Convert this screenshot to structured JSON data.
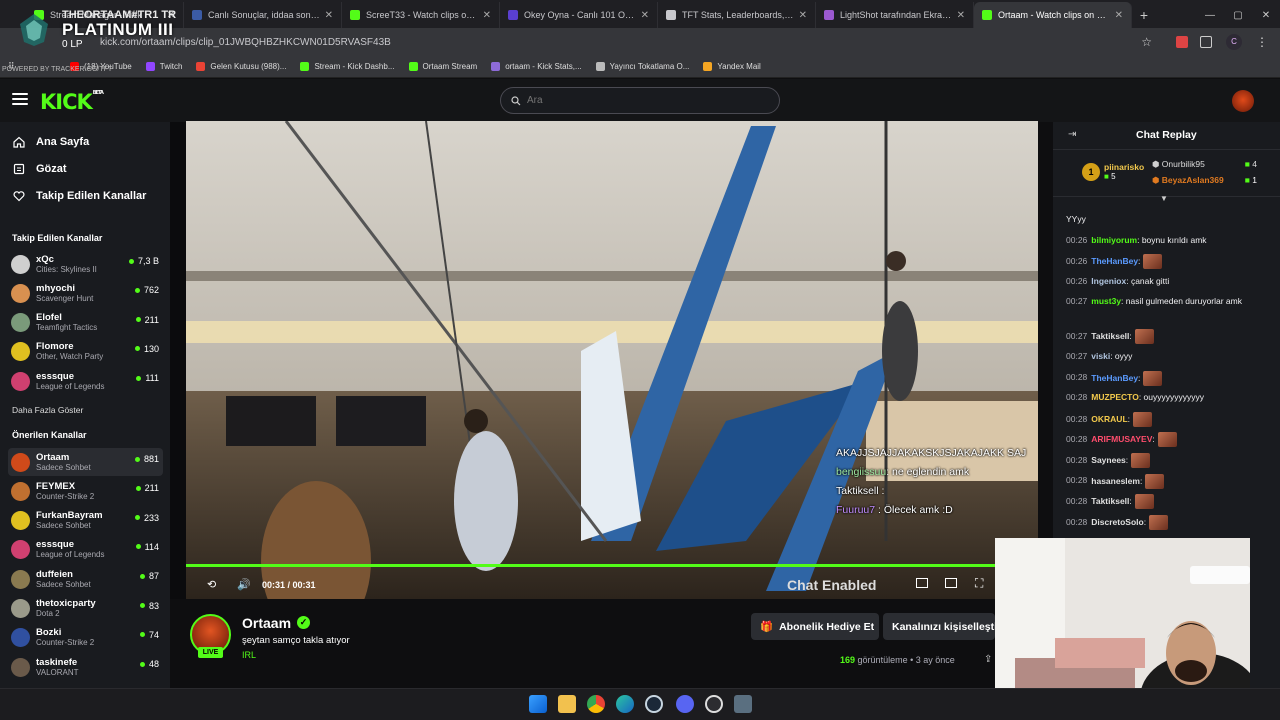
{
  "browser": {
    "tabs": [
      {
        "label": "Stream Manager · Kick",
        "favicon_color": "#53fc18",
        "active": false
      },
      {
        "label": "Canlı Sonuçlar, iddaa sonuçları",
        "favicon_color": "#3b5ba5",
        "active": false
      },
      {
        "label": "ScreeT33 - Watch clips on Kick",
        "favicon_color": "#53fc18",
        "active": false
      },
      {
        "label": "Okey Oyna - Canlı 101 Okey ve",
        "favicon_color": "#5a3fd0",
        "active": false
      },
      {
        "label": "TFT Stats, Leaderboards, League",
        "favicon_color": "#c8c8cc",
        "active": false
      },
      {
        "label": "LightShot tarafından Ekran Gör",
        "favicon_color": "#9b59d0",
        "active": false
      },
      {
        "label": "Ortaam - Watch clips on Kick",
        "favicon_color": "#53fc18",
        "active": true
      }
    ],
    "url": "kick.com/ortaam/clips/clip_01JWBQHBZHKCWN01D5RVASF43B",
    "bookmarks": [
      {
        "label": "(18) YouTube",
        "color": "#ff0000"
      },
      {
        "label": "Twitch",
        "color": "#9146ff"
      },
      {
        "label": "Gelen Kutusu (988)...",
        "color": "#ea4335"
      },
      {
        "label": "Stream - Kick Dashb...",
        "color": "#53fc18"
      },
      {
        "label": "Ortaam Stream",
        "color": "#53fc18"
      },
      {
        "label": "ortaam - Kick Stats,...",
        "color": "#8e6bd8"
      },
      {
        "label": "Yayıncı Tokatlama O...",
        "color": "#bbbbbb"
      },
      {
        "label": "Yandex Mail",
        "color": "#f5a623"
      }
    ]
  },
  "overlay": {
    "top": "THEORTAAM#TR1 TR",
    "rank": "PLATINUM III",
    "lp": "0 LP",
    "powered": "POWERED BY TRACKER.GG/TFT"
  },
  "kick": {
    "logo": "KICK",
    "logo_beta": "BETA",
    "search_placeholder": "Ara",
    "nav": [
      {
        "label": "Ana Sayfa",
        "icon": "home-icon"
      },
      {
        "label": "Gözat",
        "icon": "browse-icon"
      },
      {
        "label": "Takip Edilen Kanallar",
        "icon": "heart-icon"
      }
    ],
    "followed_title": "Takip Edilen Kanallar",
    "followed": [
      {
        "name": "xQc",
        "category": "Cities: Skylines II",
        "viewers": "7,3 B",
        "color": "#cfcfcf"
      },
      {
        "name": "mhyochi",
        "category": "Scavenger Hunt",
        "viewers": "762",
        "color": "#d89050"
      },
      {
        "name": "Elofel",
        "category": "Teamfight Tactics",
        "viewers": "211",
        "color": "#7a9a7a"
      },
      {
        "name": "Flomore",
        "category": "Other, Watch Party",
        "viewers": "130",
        "color": "#e0c020"
      },
      {
        "name": "esssque",
        "category": "League of Legends",
        "viewers": "111",
        "color": "#d04070"
      }
    ],
    "show_more": "Daha Fazla Göster",
    "recommended_title": "Önerilen Kanallar",
    "recommended": [
      {
        "name": "Ortaam",
        "category": "Sadece Sohbet",
        "viewers": "881",
        "color": "#d04a1a"
      },
      {
        "name": "FEYMEX",
        "category": "Counter-Strike 2",
        "viewers": "211",
        "color": "#c07030"
      },
      {
        "name": "FurkanBayram",
        "category": "Sadece Sohbet",
        "viewers": "233",
        "color": "#e0c020"
      },
      {
        "name": "esssque",
        "category": "League of Legends",
        "viewers": "114",
        "color": "#d04070"
      },
      {
        "name": "duffeien",
        "category": "Sadece Sohbet",
        "viewers": "87",
        "color": "#8a7a50"
      },
      {
        "name": "thetoxicparty",
        "category": "Dota 2",
        "viewers": "83",
        "color": "#9a9a8a"
      },
      {
        "name": "Bozki",
        "category": "Counter-Strike 2",
        "viewers": "74",
        "color": "#3050a0"
      },
      {
        "name": "taskinefe",
        "category": "VALORANT",
        "viewers": "48",
        "color": "#6a5a4a"
      }
    ],
    "player": {
      "time_current": "00:31",
      "time_total": "00:31",
      "chat_toggle": "Chat Enabled",
      "progress": 1.0,
      "overlay_chat": [
        {
          "user": "",
          "text": "AKAJJSJAJJAKAKSKJSJAKAJAKK SAJ"
        },
        {
          "user": "bengiissuu",
          "text": ": ne eglendin amk"
        },
        {
          "user": "Taktiksell",
          "text": " :"
        },
        {
          "user": "Fuuruu7",
          "text": " : Ölecek amk :D"
        }
      ]
    },
    "clip_info": {
      "channel": "Ortaam",
      "live_badge": "LIVE",
      "title": "şeytan samço takla atıyor",
      "category": "IRL",
      "views_count": "169",
      "views_label": "görüntüleme",
      "age": "3 ay önce",
      "gift_button": "Abonelik Hediye Et",
      "customize_button": "Kanalınızı kişiselleştirin"
    },
    "chat": {
      "title": "Chat Replay",
      "leaderboard": [
        {
          "rank": "1",
          "name": "piinarisko",
          "value": "5",
          "color": "#d4a017"
        },
        {
          "rank": "2",
          "name": "Onurbilik95",
          "value": "4",
          "color": "#cfcfcf"
        },
        {
          "rank": "3",
          "name": "BeyazAslan369",
          "value": "1",
          "color": "#e07a20"
        }
      ],
      "messages": [
        {
          "time": "",
          "user": "",
          "color": "#efeff1",
          "text": "YYyy",
          "emote": false
        },
        {
          "time": "00:26",
          "user": "bilmiyorum",
          "color": "#53fc18",
          "text": ": boynu kırıldı amk",
          "emote": false
        },
        {
          "time": "00:26",
          "user": "TheHanBey",
          "color": "#5b9bff",
          "text": ":",
          "emote": true
        },
        {
          "time": "00:26",
          "user": "Ingeniox",
          "color": "#b0c4de",
          "text": ": çanak gitti",
          "emote": false
        },
        {
          "time": "00:27",
          "user": "must3y",
          "color": "#53fc18",
          "text": ": nasil gulmeden duruyorlar amk",
          "emote": false
        },
        {
          "time": "00:27",
          "user": "Taktiksell",
          "color": "#e0e0e0",
          "text": ":",
          "emote": true
        },
        {
          "time": "00:27",
          "user": "viski",
          "color": "#b0c4de",
          "text": ": oyyy",
          "emote": false
        },
        {
          "time": "00:28",
          "user": "TheHanBey",
          "color": "#5b9bff",
          "text": ":",
          "emote": true
        },
        {
          "time": "00:28",
          "user": "MUZPECTO",
          "color": "#f2c94c",
          "text": ": ouyyyyyyyyyyyy",
          "emote": false
        },
        {
          "time": "00:28",
          "user": "OKRAUL",
          "color": "#f2c94c",
          "text": ":",
          "emote": true
        },
        {
          "time": "00:28",
          "user": "ARIFMUSAYEV",
          "color": "#ff4d6d",
          "text": ":",
          "emote": true
        },
        {
          "time": "00:28",
          "user": "Saynees",
          "color": "#e0e0e0",
          "text": ":",
          "emote": true
        },
        {
          "time": "00:28",
          "user": "hasaneslem",
          "color": "#e0e0e0",
          "text": ":",
          "emote": true
        },
        {
          "time": "00:28",
          "user": "Taktiksell",
          "color": "#e0e0e0",
          "text": ":",
          "emote": true
        },
        {
          "time": "00:28",
          "user": "DiscretoSolo",
          "color": "#e0e0e0",
          "text": ":",
          "emote": true
        }
      ]
    }
  }
}
